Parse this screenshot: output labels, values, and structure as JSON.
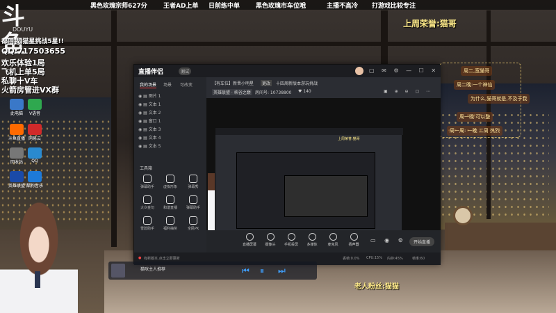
{
  "banner": {
    "items": [
      "黑色玫瑰宗师627分",
      "王者AD上单",
      "日前练中单",
      "黑色玫瑰市车位哦",
      "主播不高冷",
      "打游戏比较专注"
    ]
  },
  "overlay_left": {
    "logo": "斗鱼",
    "logo_sub": "DOUYU",
    "lines": [
      "都叫我,猫星挑战5星!!",
      "QQ:717503655",
      "欢乐体验1局",
      "飞机上单5局",
      "私聊十V车",
      "火箭房管进VX群"
    ]
  },
  "overlay_right": {
    "title": "上周荣誉:猫哥",
    "gift_items": [
      "周二,宽猫哥",
      "周二晚:一个神仙",
      "为什么,猫哥就是,不及于我",
      "周一晚:可以整",
      "周一周: 一晚 二周 热烈"
    ],
    "bottom_name": "老人粉丝:猫猫"
  },
  "desktop_icons": [
    {
      "label": "此电脑",
      "color": "#3a78c8"
    },
    {
      "label": "V语音",
      "color": "#2fa84f"
    },
    {
      "label": "斗鱼直播",
      "color": "#ff6a00"
    },
    {
      "label": "网易云",
      "color": "#d02a2a"
    },
    {
      "label": "回收站",
      "color": "#777777"
    },
    {
      "label": "QQ",
      "color": "#2a8ad0"
    },
    {
      "label": "英雄联盟",
      "color": "#1a4aa8"
    },
    {
      "label": "酷狗音乐",
      "color": "#1e7ad8"
    }
  ],
  "app": {
    "brand": "直播伴侣",
    "badge": "测试",
    "left_tabs": [
      "我的场景",
      "场景",
      "可改变"
    ],
    "scenes": [
      "图片 1",
      "文本 1",
      "文本 2",
      "窗口 1",
      "文本 3",
      "文本 4",
      "文本 5"
    ],
    "tools_title": "工具箱",
    "tools": [
      "弹幕助手",
      "虚拟形象",
      "弹幕秀",
      "大众金句",
      "和谐直播",
      "弹幕助手",
      "雪碧助手",
      "福利抽奖",
      "全民PK"
    ],
    "room_title": "【有车位】新晋小明星",
    "room_tag": "更改",
    "room_edit": "十四周新版本游玩挑战",
    "category": "英雄联盟 · 峡谷之巅",
    "room_no": "房间号: 10738800",
    "online": "140",
    "bottom_buttons": [
      "直播屏幕",
      "摄像头",
      "手机投屏",
      "多媒体",
      "麦克风",
      "扬声器"
    ],
    "live_button": "开始直播",
    "status_left": "有新版本,点击立即更新",
    "status_right": [
      "丢帧:0.0%",
      "CPU:15%",
      "内存:45%",
      "帧率:60"
    ],
    "nested_title": "上周荣誉:猫哥"
  },
  "player": {
    "song": "猫咪主人推荐",
    "controls": [
      "previous",
      "pause",
      "next"
    ]
  },
  "colors": {
    "accent": "#3fa0ff",
    "gold": "#ffeb8a",
    "window_bg": "#2b2d33",
    "red": "#f44444"
  }
}
